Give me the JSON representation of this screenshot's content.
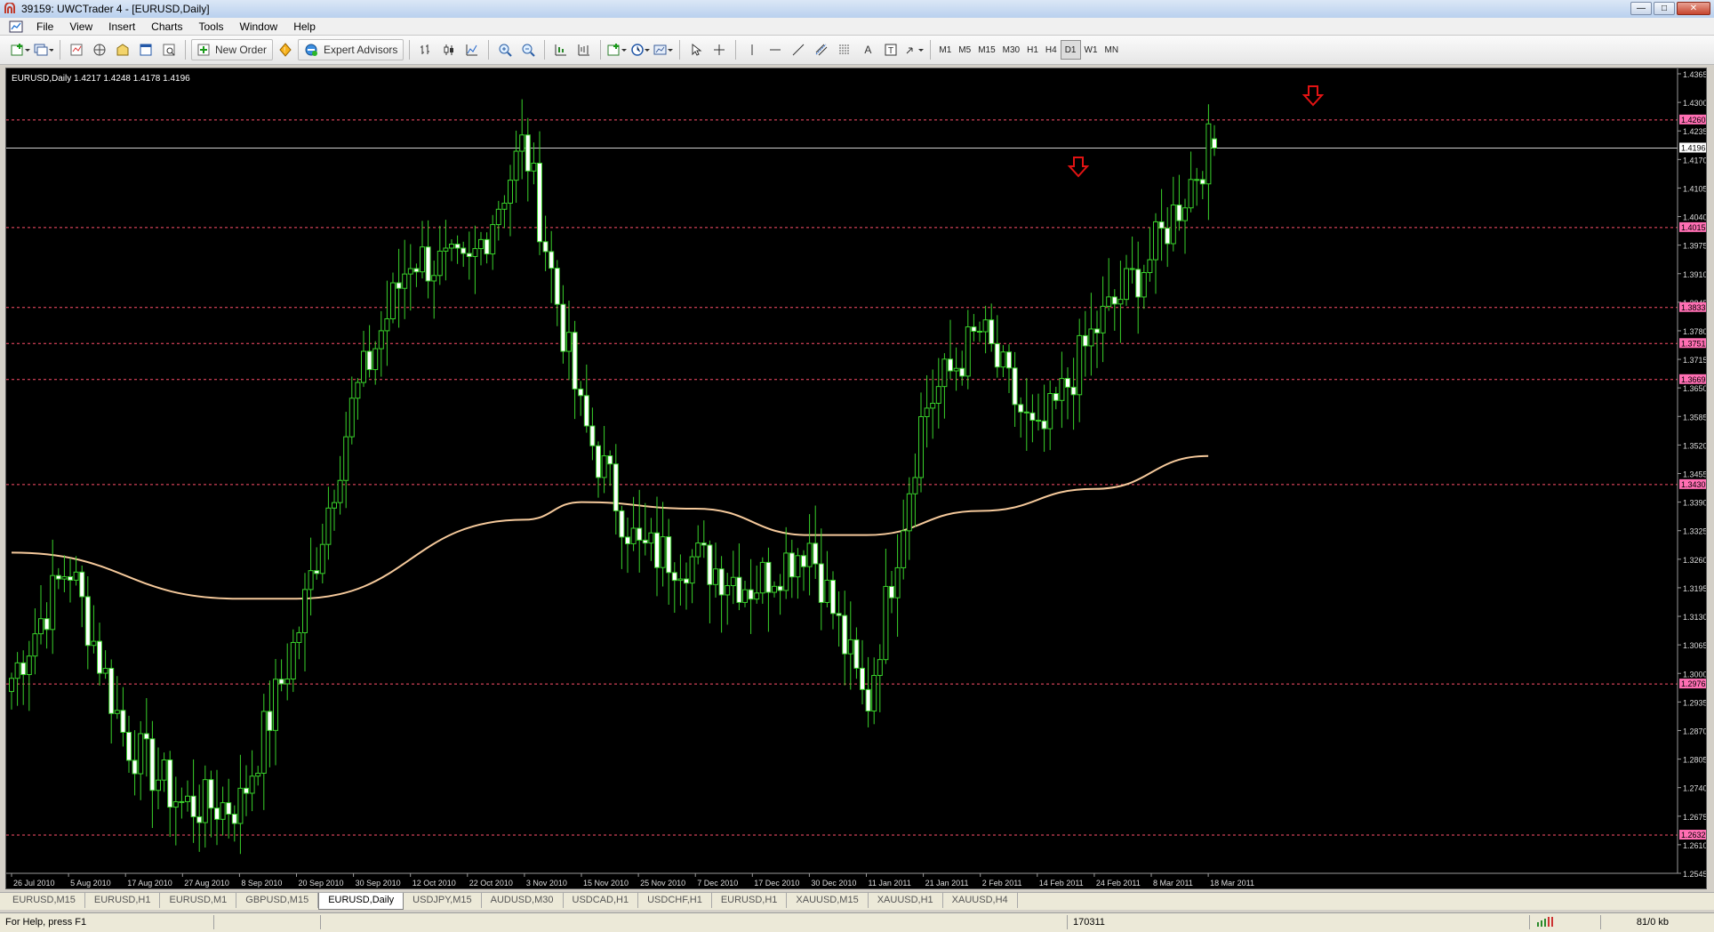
{
  "window": {
    "title": "39159: UWCTrader 4 - [EURUSD,Daily]",
    "buttons": [
      "minimize",
      "maximize",
      "close"
    ]
  },
  "menu": [
    "File",
    "View",
    "Insert",
    "Charts",
    "Tools",
    "Window",
    "Help"
  ],
  "toolbar": {
    "new_order_label": "New Order",
    "expert_advisors_label": "Expert Advisors",
    "timeframes": [
      "M1",
      "M5",
      "M15",
      "M30",
      "H1",
      "H4",
      "D1",
      "W1",
      "MN"
    ],
    "active_timeframe": "D1"
  },
  "chart": {
    "info": "EURUSD,Daily  1.4217 1.4248 1.4178 1.4196",
    "current_price": "1.4196",
    "price_ticks": [
      "1.4365",
      "1.4300",
      "1.4235",
      "1.4170",
      "1.4105",
      "1.4040",
      "1.3975",
      "1.3910",
      "1.3845",
      "1.3780",
      "1.3715",
      "1.3650",
      "1.3585",
      "1.3520",
      "1.3455",
      "1.3390",
      "1.3325",
      "1.3260",
      "1.3195",
      "1.3130",
      "1.3065",
      "1.3000",
      "1.2935",
      "1.2870",
      "1.2805",
      "1.2740",
      "1.2675",
      "1.2610",
      "1.2545"
    ],
    "level_labels": [
      "1.4260",
      "1.4015",
      "1.3833",
      "1.3751",
      "1.3669",
      "1.3430",
      "1.2976",
      "1.2632"
    ],
    "date_labels": [
      "26 Jul 2010",
      "5 Aug 2010",
      "17 Aug 2010",
      "27 Aug 2010",
      "8 Sep 2010",
      "20 Sep 2010",
      "30 Sep 2010",
      "12 Oct 2010",
      "22 Oct 2010",
      "3 Nov 2010",
      "15 Nov 2010",
      "25 Nov 2010",
      "7 Dec 2010",
      "17 Dec 2010",
      "30 Dec 2010",
      "11 Jan 2011",
      "21 Jan 2011",
      "2 Feb 2011",
      "14 Feb 2011",
      "24 Feb 2011",
      "8 Mar 2011",
      "18 Mar 2011"
    ],
    "colors": {
      "background": "#000000",
      "candle": "#39d22b",
      "candle_body_bull": "#000000",
      "candle_body_bear": "#ffffff",
      "moving_average": "#f5c99b",
      "level_line": "#ff4f6b",
      "level_label_bg": "#ff6fb3",
      "arrow": "#e21313"
    }
  },
  "chart_data": {
    "type": "candlestick",
    "symbol": "EURUSD",
    "timeframe": "Daily",
    "ylim": [
      1.2545,
      1.4365
    ],
    "horizontal_levels": [
      1.426,
      1.4015,
      1.3833,
      1.3751,
      1.3669,
      1.343,
      1.2976,
      1.2632
    ],
    "current_price": 1.4196,
    "last_bar": {
      "open": 1.4217,
      "high": 1.4248,
      "low": 1.4178,
      "close": 1.4196
    },
    "close_path": [
      [
        "26 Jul 2010",
        1.299
      ],
      [
        "5 Aug 2010",
        1.325
      ],
      [
        "17 Aug 2010",
        1.285
      ],
      [
        "27 Aug 2010",
        1.27
      ],
      [
        "8 Sep 2010",
        1.27
      ],
      [
        "20 Sep 2010",
        1.308
      ],
      [
        "30 Sep 2010",
        1.362
      ],
      [
        "12 Oct 2010",
        1.395
      ],
      [
        "22 Oct 2010",
        1.391
      ],
      [
        "3 Nov 2010",
        1.421
      ],
      [
        "15 Nov 2010",
        1.358
      ],
      [
        "25 Nov 2010",
        1.328
      ],
      [
        "7 Dec 2010",
        1.326
      ],
      [
        "17 Dec 2010",
        1.32
      ],
      [
        "30 Dec 2010",
        1.33
      ],
      [
        "11 Jan 2011",
        1.292
      ],
      [
        "21 Jan 2011",
        1.36
      ],
      [
        "2 Feb 2011",
        1.378
      ],
      [
        "14 Feb 2011",
        1.352
      ],
      [
        "24 Feb 2011",
        1.378
      ],
      [
        "8 Mar 2011",
        1.395
      ],
      [
        "18 Mar 2011",
        1.4196
      ]
    ],
    "moving_average": [
      [
        "26 Jul 2010",
        1.3275
      ],
      [
        "8 Sep 2010",
        1.317
      ],
      [
        "20 Sep 2010",
        1.317
      ],
      [
        "3 Nov 2010",
        1.335
      ],
      [
        "15 Nov 2010",
        1.339
      ],
      [
        "7 Dec 2010",
        1.3375
      ],
      [
        "30 Dec 2010",
        1.3315
      ],
      [
        "11 Jan 2011",
        1.3315
      ],
      [
        "2 Feb 2011",
        1.337
      ],
      [
        "24 Feb 2011",
        1.342
      ],
      [
        "18 Mar 2011",
        1.3495
      ]
    ],
    "annotations": [
      "down arrow near 1.4015 (mid Feb 2011)",
      "down arrow above 1.4260 (late Mar 2011)"
    ]
  },
  "tabs": [
    "EURUSD,M15",
    "EURUSD,H1",
    "EURUSD,M1",
    "GBPUSD,M15",
    "EURUSD,Daily",
    "USDJPY,M15",
    "AUDUSD,M30",
    "USDCAD,H1",
    "USDCHF,H1",
    "EURUSD,H1",
    "XAUUSD,M15",
    "XAUUSD,H1",
    "XAUUSD,H4"
  ],
  "active_tab": "EURUSD,Daily",
  "status": {
    "help": "For Help, press F1",
    "bars": "170311",
    "traffic": "81/0 kb"
  }
}
